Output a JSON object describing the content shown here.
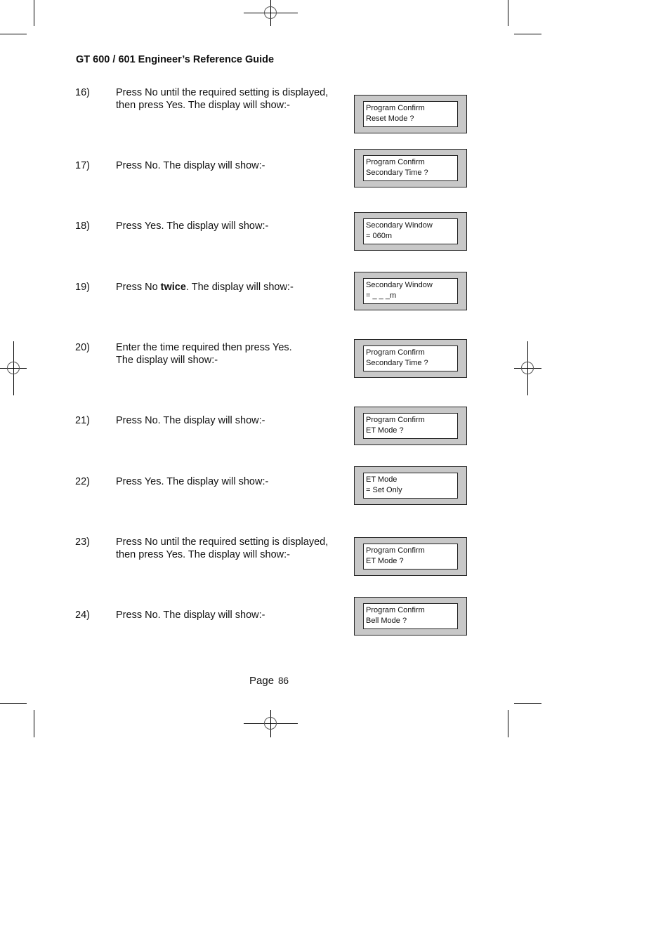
{
  "header": {
    "title": "GT 600 / 601 Engineer’s Reference Guide"
  },
  "steps": [
    {
      "num": "16)",
      "line1": "Press No until the required setting is displayed,",
      "line2": "then press Yes. The display will show:-",
      "display": {
        "line1": "Program Confirm",
        "line2": "Reset Mode ?"
      }
    },
    {
      "num": "17)",
      "line1": "Press No. The display will show:-",
      "line2": "",
      "display": {
        "line1": "Program Confirm",
        "line2": "Secondary Time ?"
      }
    },
    {
      "num": "18)",
      "line1": "Press Yes. The display will show:-",
      "line2": "",
      "display": {
        "line1": "Secondary Window",
        "line2": "= 060m"
      }
    },
    {
      "num": "19)",
      "line1_pre": "Press No ",
      "line1_bold": "twice",
      "line1_post": ". The display will show:-",
      "line2": "",
      "display": {
        "line1": "Secondary Window",
        "line2": "= _ _ _m"
      }
    },
    {
      "num": "20)",
      "line1": "Enter the time required then press Yes.",
      "line2": "The display will show:-",
      "display": {
        "line1": "Program Confirm",
        "line2": "Secondary Time ?"
      }
    },
    {
      "num": "21)",
      "line1": "Press No. The display will show:-",
      "line2": "",
      "display": {
        "line1": "Program Confirm",
        "line2": "ET Mode ?"
      }
    },
    {
      "num": "22)",
      "line1": "Press Yes. The display will show:-",
      "line2": "",
      "display": {
        "line1": "ET Mode",
        "line2": "= Set Only"
      }
    },
    {
      "num": "23)",
      "line1": "Press No until the required setting is displayed,",
      "line2": "then press Yes. The display will show:-",
      "display": {
        "line1": "Program Confirm",
        "line2": "ET Mode ?"
      }
    },
    {
      "num": "24)",
      "line1": "Press No. The display will show:-",
      "line2": "",
      "display": {
        "line1": "Program Confirm",
        "line2": "Bell Mode ?"
      }
    }
  ],
  "footer": {
    "page_label": "Page",
    "page_number": "86"
  }
}
